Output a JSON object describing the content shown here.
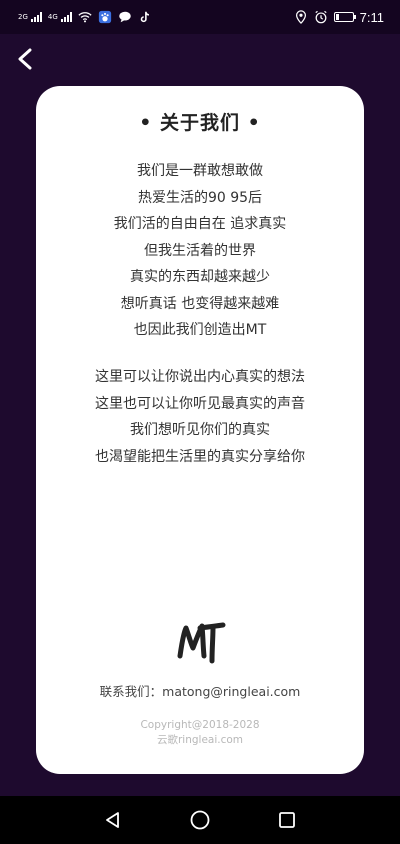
{
  "status_bar": {
    "network_1": "2G",
    "network_2": "4G",
    "time": "7:11"
  },
  "header": {
    "back_icon": "chevron-left-icon"
  },
  "card": {
    "title": "• 关于我们 •",
    "paragraph_1": [
      "我们是一群敢想敢做",
      "热爱生活的90 95后",
      "我们活的自由自在 追求真实",
      "但我生活着的世界",
      "真实的东西却越来越少",
      "想听真话 也变得越来越难",
      "也因此我们创造出MT"
    ],
    "paragraph_2": [
      "这里可以让你说出内心真实的想法",
      "这里也可以让你听见最真实的声音",
      "我们想听见你们的真实",
      "也渴望能把生活里的真实分享给你"
    ],
    "logo_text": "MT",
    "contact": "联系我们：matong@ringleai.com",
    "copyright_1": "Copyright@2018-2028",
    "copyright_2": "云歌ringleai.com"
  },
  "colors": {
    "background": "#1e0a2e",
    "card": "#ffffff",
    "text": "#333333"
  }
}
